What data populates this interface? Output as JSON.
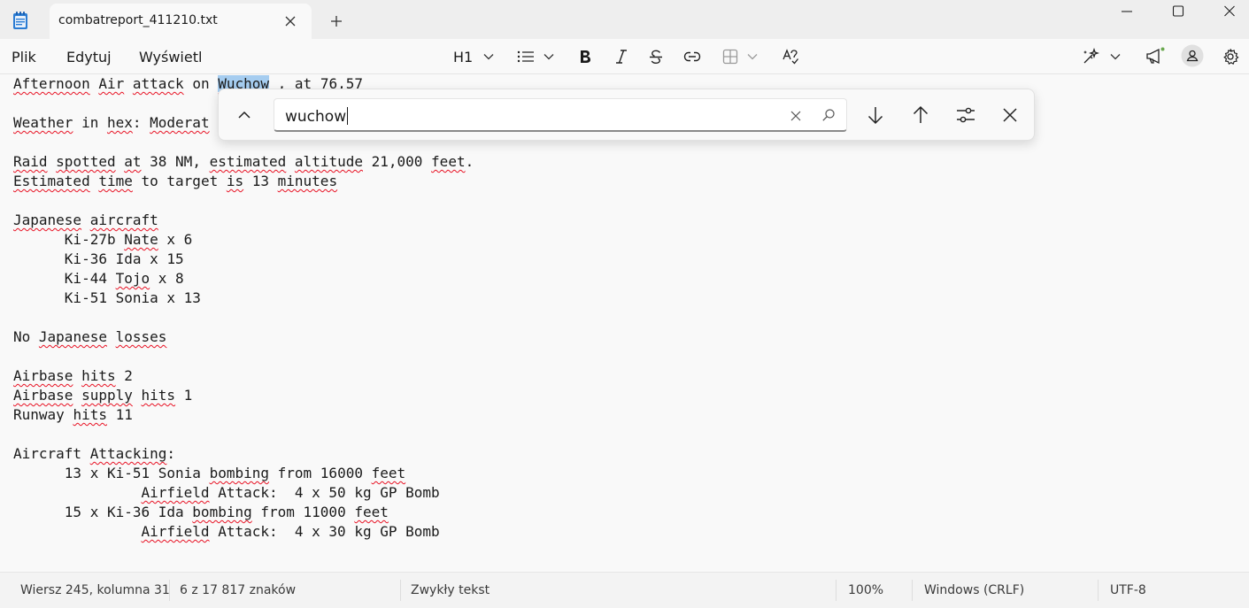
{
  "titlebar": {
    "tab_title": "combatreport_411210.txt"
  },
  "menu": {
    "file": "Plik",
    "edit": "Edytuj",
    "view": "Wyświetl"
  },
  "toolbar": {
    "heading_label": "H1"
  },
  "find": {
    "query": "wuchow"
  },
  "document": {
    "lines": [
      [
        {
          "t": "Afternoon",
          "s": 1
        },
        {
          "t": " "
        },
        {
          "t": "Air",
          "s": 1
        },
        {
          "t": " "
        },
        {
          "t": "attack",
          "s": 1
        },
        {
          "t": " on "
        },
        {
          "t": "Wuchow",
          "h": 1,
          "s": 1
        },
        {
          "t": " , at 76,57"
        }
      ],
      [],
      [
        {
          "t": "Weather",
          "s": 1
        },
        {
          "t": " in "
        },
        {
          "t": "hex",
          "s": 1
        },
        {
          "t": ": "
        },
        {
          "t": "Moderat",
          "s": 1
        }
      ],
      [],
      [
        {
          "t": "Raid",
          "s": 1
        },
        {
          "t": " "
        },
        {
          "t": "spotted",
          "s": 1
        },
        {
          "t": " "
        },
        {
          "t": "at",
          "s": 1
        },
        {
          "t": " 38 NM, "
        },
        {
          "t": "estimated",
          "s": 1
        },
        {
          "t": " "
        },
        {
          "t": "altitude",
          "s": 1
        },
        {
          "t": " 21,000 "
        },
        {
          "t": "feet",
          "s": 1
        },
        {
          "t": "."
        }
      ],
      [
        {
          "t": "Estimated",
          "s": 1
        },
        {
          "t": " "
        },
        {
          "t": "time",
          "s": 1
        },
        {
          "t": " to target "
        },
        {
          "t": "is",
          "s": 1
        },
        {
          "t": " 13 "
        },
        {
          "t": "minutes",
          "s": 1
        }
      ],
      [],
      [
        {
          "t": "Japanese",
          "s": 1
        },
        {
          "t": " "
        },
        {
          "t": "aircraft",
          "s": 1
        }
      ],
      [
        {
          "t": "      Ki-27b "
        },
        {
          "t": "Nate",
          "s": 1
        },
        {
          "t": " x 6"
        }
      ],
      [
        {
          "t": "      Ki-36 Ida x 15"
        }
      ],
      [
        {
          "t": "      Ki-44 "
        },
        {
          "t": "Tojo",
          "s": 1
        },
        {
          "t": " x 8"
        }
      ],
      [
        {
          "t": "      Ki-51 Sonia x 13"
        }
      ],
      [],
      [
        {
          "t": "No "
        },
        {
          "t": "Japanese",
          "s": 1
        },
        {
          "t": " "
        },
        {
          "t": "losses",
          "s": 1
        }
      ],
      [],
      [
        {
          "t": "Airbase",
          "s": 1
        },
        {
          "t": " "
        },
        {
          "t": "hits",
          "s": 1
        },
        {
          "t": " 2"
        }
      ],
      [
        {
          "t": "Airbase",
          "s": 1
        },
        {
          "t": " "
        },
        {
          "t": "supply",
          "s": 1
        },
        {
          "t": " "
        },
        {
          "t": "hits",
          "s": 1
        },
        {
          "t": " 1"
        }
      ],
      [
        {
          "t": "Runway "
        },
        {
          "t": "hits",
          "s": 1
        },
        {
          "t": " 11"
        }
      ],
      [],
      [
        {
          "t": "Aircraft "
        },
        {
          "t": "Attacking",
          "s": 1
        },
        {
          "t": ":"
        }
      ],
      [
        {
          "t": "      13 x Ki-51 Sonia "
        },
        {
          "t": "bombing",
          "s": 1
        },
        {
          "t": " from 16000 "
        },
        {
          "t": "feet",
          "s": 1
        }
      ],
      [
        {
          "t": "               "
        },
        {
          "t": "Airfield",
          "s": 1
        },
        {
          "t": " Attack:  4 x 50 kg GP Bomb"
        }
      ],
      [
        {
          "t": "      15 x Ki-36 Ida "
        },
        {
          "t": "bombing",
          "s": 1
        },
        {
          "t": " from 11000 "
        },
        {
          "t": "feet",
          "s": 1
        }
      ],
      [
        {
          "t": "               "
        },
        {
          "t": "Airfield",
          "s": 1
        },
        {
          "t": " Attack:  4 x 30 kg GP Bomb"
        }
      ]
    ]
  },
  "status": {
    "position": "Wiersz 245, kolumna 31",
    "selection": "6 z 17 817 znaków",
    "format": "Zwykły tekst",
    "zoom": "100%",
    "line_ending": "Windows (CRLF)",
    "encoding": "UTF-8"
  },
  "colors": {
    "accent": "#a6cdf0",
    "spell_underline": "#e81123"
  },
  "icons": [
    "notepad-icon",
    "close-icon",
    "plus-icon",
    "minimize-icon",
    "maximize-icon",
    "list-icon",
    "bold-icon",
    "italic-icon",
    "strikethrough-icon",
    "link-icon",
    "table-icon",
    "spellcheck-icon",
    "copilot-icon",
    "megaphone-icon",
    "account-icon",
    "gear-icon",
    "chevron-up-icon",
    "search-icon",
    "arrow-down-icon",
    "arrow-up-icon",
    "options-icon"
  ]
}
